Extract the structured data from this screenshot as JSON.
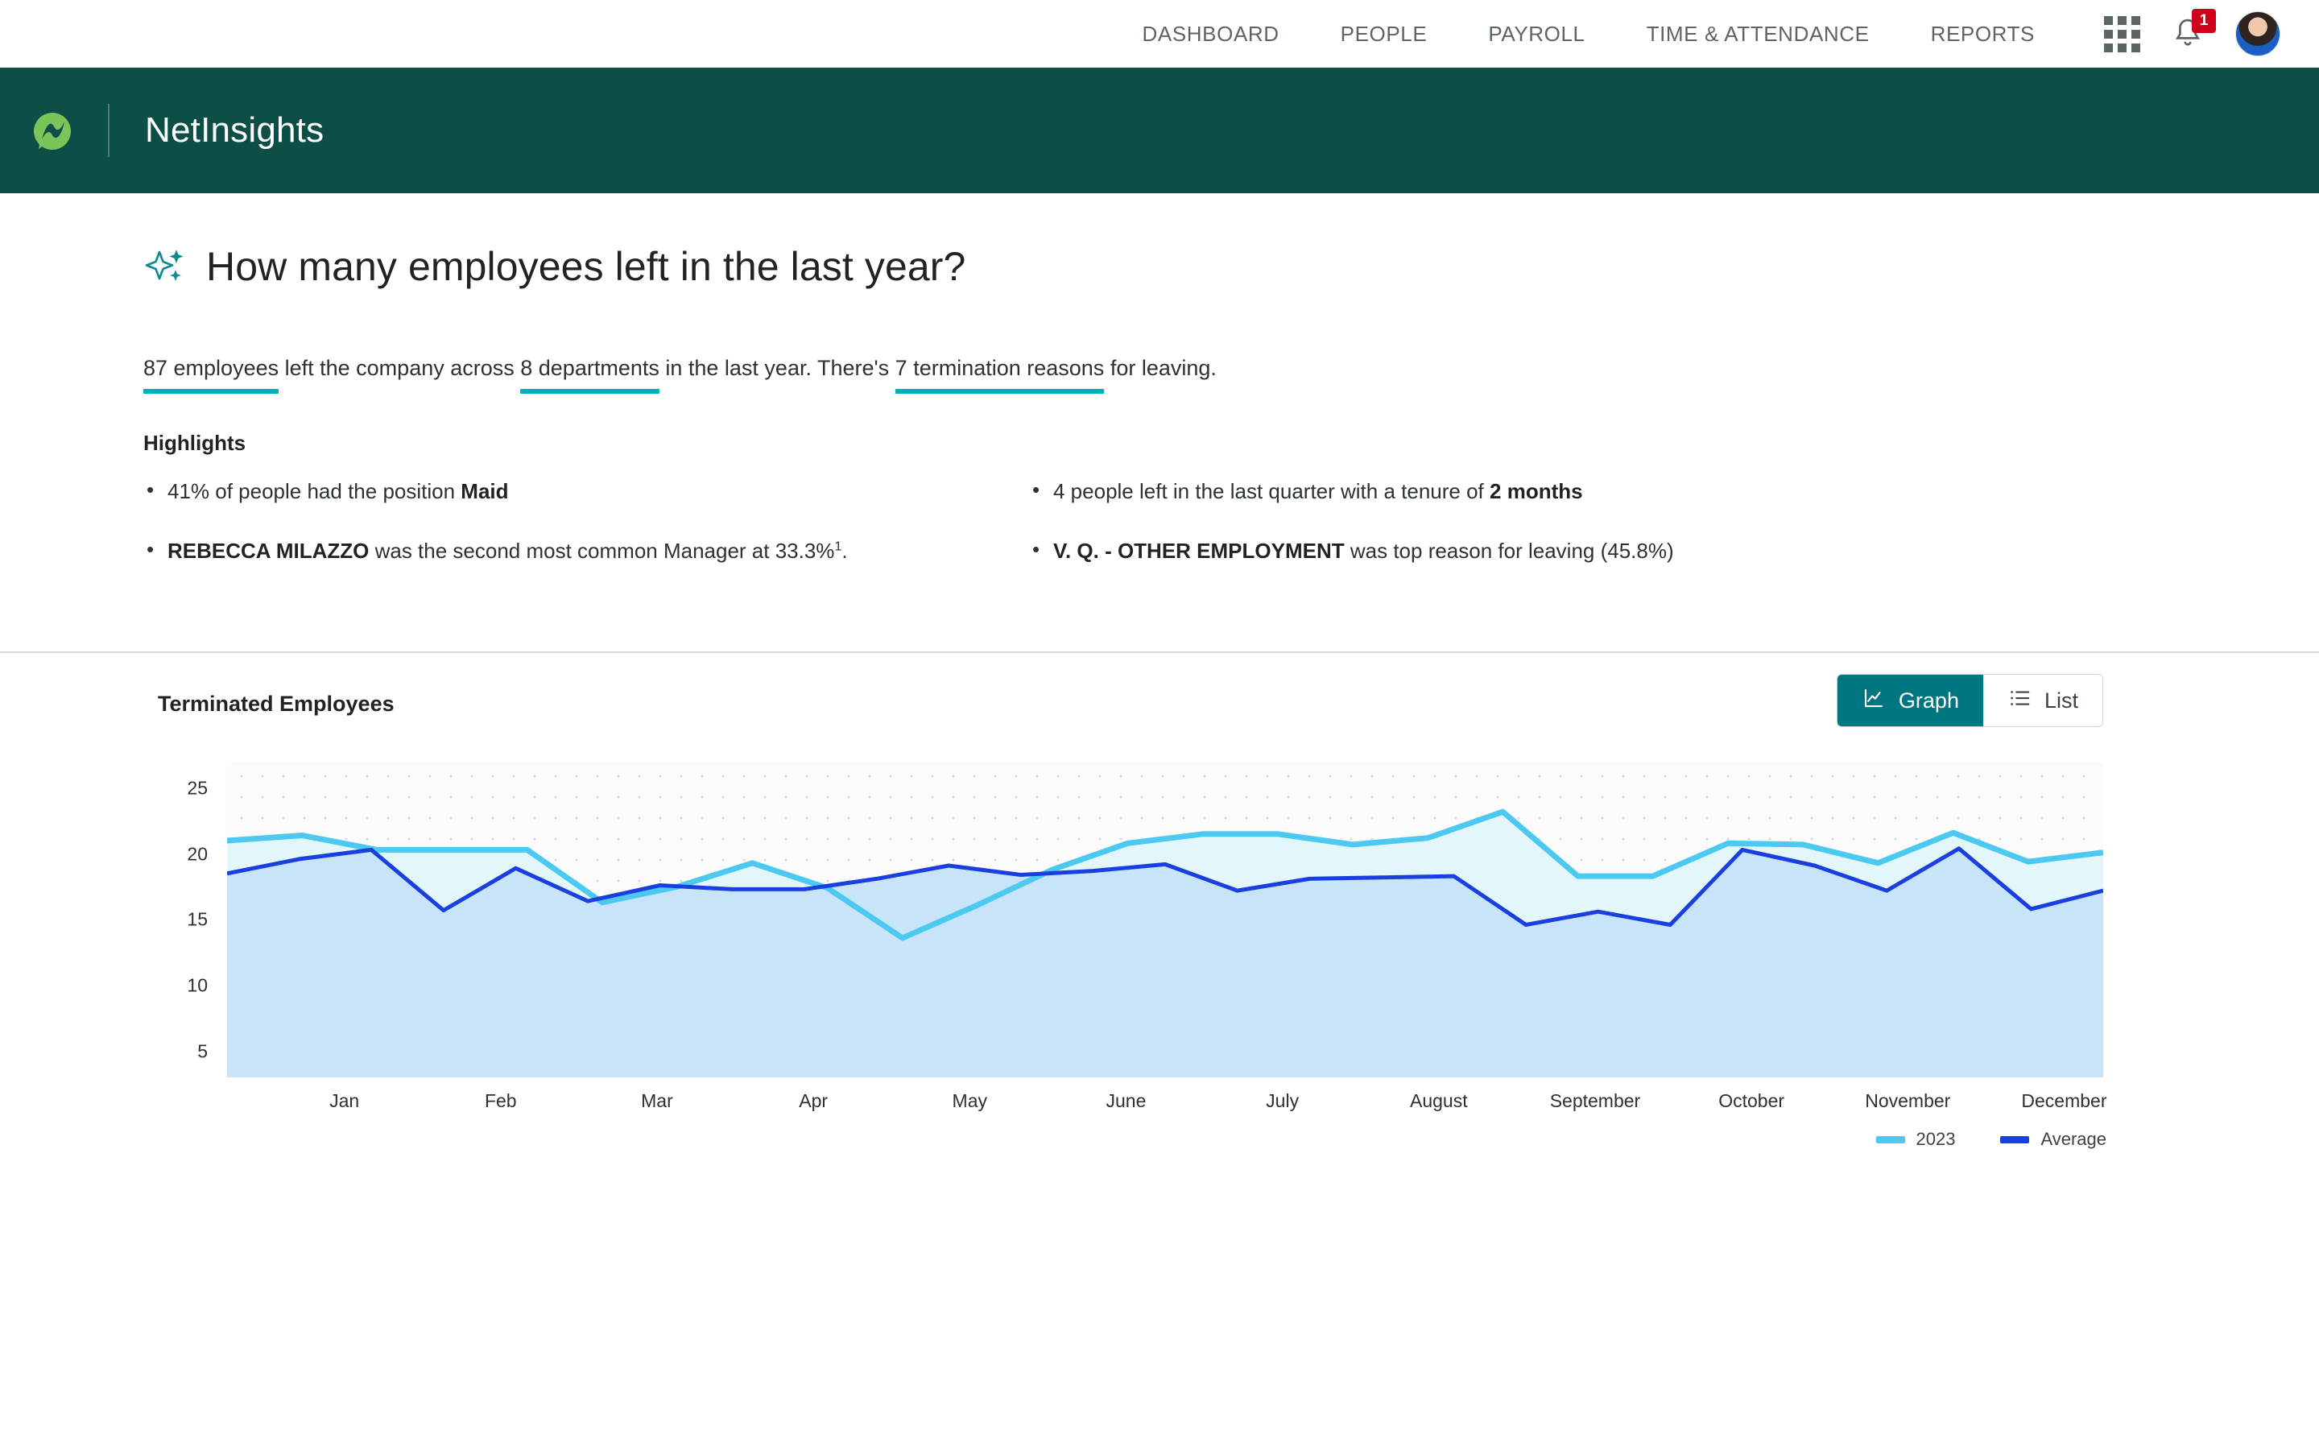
{
  "topnav": {
    "items": [
      {
        "label": "DASHBOARD",
        "name": "nav-dashboard"
      },
      {
        "label": "PEOPLE",
        "name": "nav-people"
      },
      {
        "label": "PAYROLL",
        "name": "nav-payroll"
      },
      {
        "label": "TIME & ATTENDANCE",
        "name": "nav-time-attendance"
      },
      {
        "label": "REPORTS",
        "name": "nav-reports"
      }
    ],
    "apps_icon": "grid-apps-icon",
    "notifications_icon": "bell-icon",
    "notification_count": "1",
    "avatar_icon": "user-avatar"
  },
  "brand": {
    "logo_icon": "netinsights-leaf-logo",
    "name": "NetInsights",
    "bar_color": "#0d4f47"
  },
  "insight": {
    "sparkle_icon": "ai-sparkle-icon",
    "headline": "How many employees left in the last year?",
    "summary": {
      "part1": "87 employees",
      "part2": " left the company across ",
      "part3": "8 departments",
      "part4": " in the last year. There's ",
      "part5": "7 termination reasons",
      "part6": " for leaving.",
      "underline_color": "#00b0b9"
    },
    "highlights_title": "Highlights",
    "highlights_left": [
      {
        "pre": "41% of people had the position ",
        "bold": "Maid",
        "post": ""
      },
      {
        "pre": "",
        "bold": "REBECCA MILAZZO",
        "post": " was the second most common Manager at 33.3%",
        "sup": "1",
        "tail": "."
      }
    ],
    "highlights_right": [
      {
        "pre": "4 people left in the last quarter with a tenure of ",
        "bold": "2 months",
        "post": ""
      },
      {
        "pre": "",
        "bold": "V. Q. - OTHER EMPLOYMENT",
        "post": " was top reason for leaving (45.8%)"
      }
    ]
  },
  "chart_section": {
    "title": "Terminated Employees",
    "toggle": {
      "graph_label": "Graph",
      "graph_icon": "line-chart-icon",
      "list_label": "List",
      "list_icon": "list-icon",
      "active": "Graph",
      "active_color": "#007681"
    }
  },
  "chart_data": {
    "type": "area",
    "title": "Terminated Employees",
    "xlabel": "",
    "ylabel": "",
    "ylim": [
      3,
      27
    ],
    "yticks": [
      25,
      20,
      15,
      10,
      5
    ],
    "grid": "dotted",
    "legend_position": "bottom-right",
    "categories": [
      "Jan",
      "Feb",
      "Mar",
      "Apr",
      "May",
      "June",
      "July",
      "August",
      "September",
      "October",
      "November",
      "December"
    ],
    "x_points": 25,
    "series": [
      {
        "name": "2023",
        "color": "#4cc9f0",
        "fill": "#cde9fa",
        "values": [
          21,
          21.4,
          20.3,
          20.3,
          20.3,
          16.3,
          17.5,
          19.3,
          17.4,
          13.6,
          16.1,
          18.8,
          20.8,
          21.5,
          21.5,
          20.7,
          21.2,
          23.2,
          18.3,
          18.3,
          20.8,
          20.7,
          19.3,
          21.6,
          19.4,
          20.1
        ]
      },
      {
        "name": "Average",
        "color": "#1a3fe0",
        "values": [
          18.5,
          19.6,
          20.3,
          15.7,
          18.9,
          16.4,
          17.6,
          17.3,
          17.3,
          18.1,
          19.1,
          18.4,
          18.7,
          19.2,
          17.2,
          18.1,
          18.2,
          18.3,
          14.6,
          15.6,
          14.6,
          20.3,
          19.1,
          17.2,
          20.4,
          15.8,
          17.2
        ]
      }
    ],
    "legend": [
      {
        "label": "2023",
        "color": "#4cc9f0"
      },
      {
        "label": "Average",
        "color": "#1a3fe0"
      }
    ]
  }
}
